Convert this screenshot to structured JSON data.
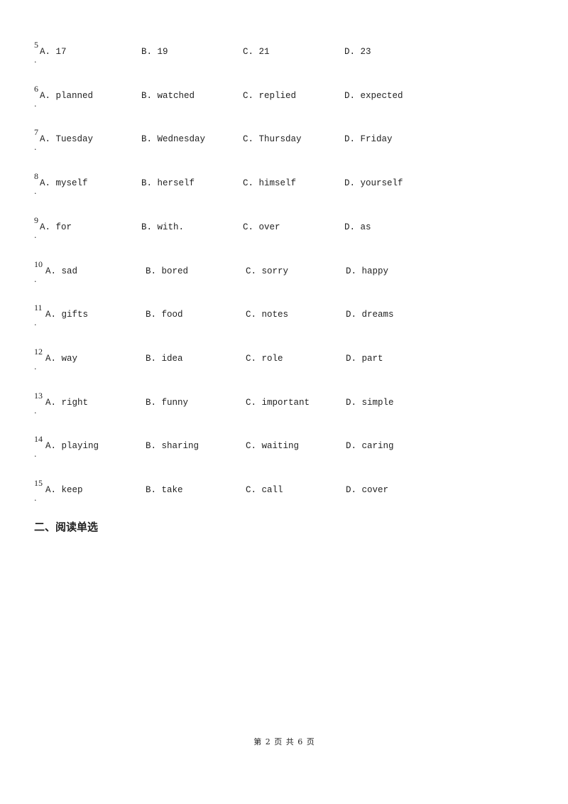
{
  "questions": [
    {
      "number": "5",
      "dot": ".",
      "options": [
        "A. 17",
        "B. 19",
        "C. 21",
        "D. 23"
      ]
    },
    {
      "number": "6",
      "dot": ".",
      "options": [
        "A. planned",
        "B. watched",
        "C. replied",
        "D. expected"
      ]
    },
    {
      "number": "7",
      "dot": ".",
      "options": [
        "A. Tuesday",
        "B. Wednesday",
        "C. Thursday",
        "D. Friday"
      ]
    },
    {
      "number": "8",
      "dot": ".",
      "options": [
        "A. myself",
        "B. herself",
        "C. himself",
        "D. yourself"
      ]
    },
    {
      "number": "9",
      "dot": ".",
      "options": [
        "A. for",
        "B. with.",
        "C. over",
        "D. as"
      ]
    },
    {
      "number": "10",
      "dot": ".",
      "options": [
        "A. sad",
        "B. bored",
        "C. sorry",
        "D. happy"
      ]
    },
    {
      "number": "11",
      "dot": ".",
      "options": [
        "A. gifts",
        "B. food",
        "C. notes",
        "D. dreams"
      ]
    },
    {
      "number": "12",
      "dot": ".",
      "options": [
        "A. way",
        "B. idea",
        "C. role",
        "D. part"
      ]
    },
    {
      "number": "13",
      "dot": ".",
      "options": [
        "A. right",
        "B. funny",
        "C. important",
        "D. simple"
      ]
    },
    {
      "number": "14",
      "dot": ".",
      "options": [
        "A. playing",
        "B. sharing",
        "C. waiting",
        "D. caring"
      ]
    },
    {
      "number": "15",
      "dot": ".",
      "options": [
        "A. keep",
        "B. take",
        "C. call",
        "D. cover"
      ]
    }
  ],
  "section_heading": "二、阅读单选",
  "footer": "第 2 页 共 6 页"
}
